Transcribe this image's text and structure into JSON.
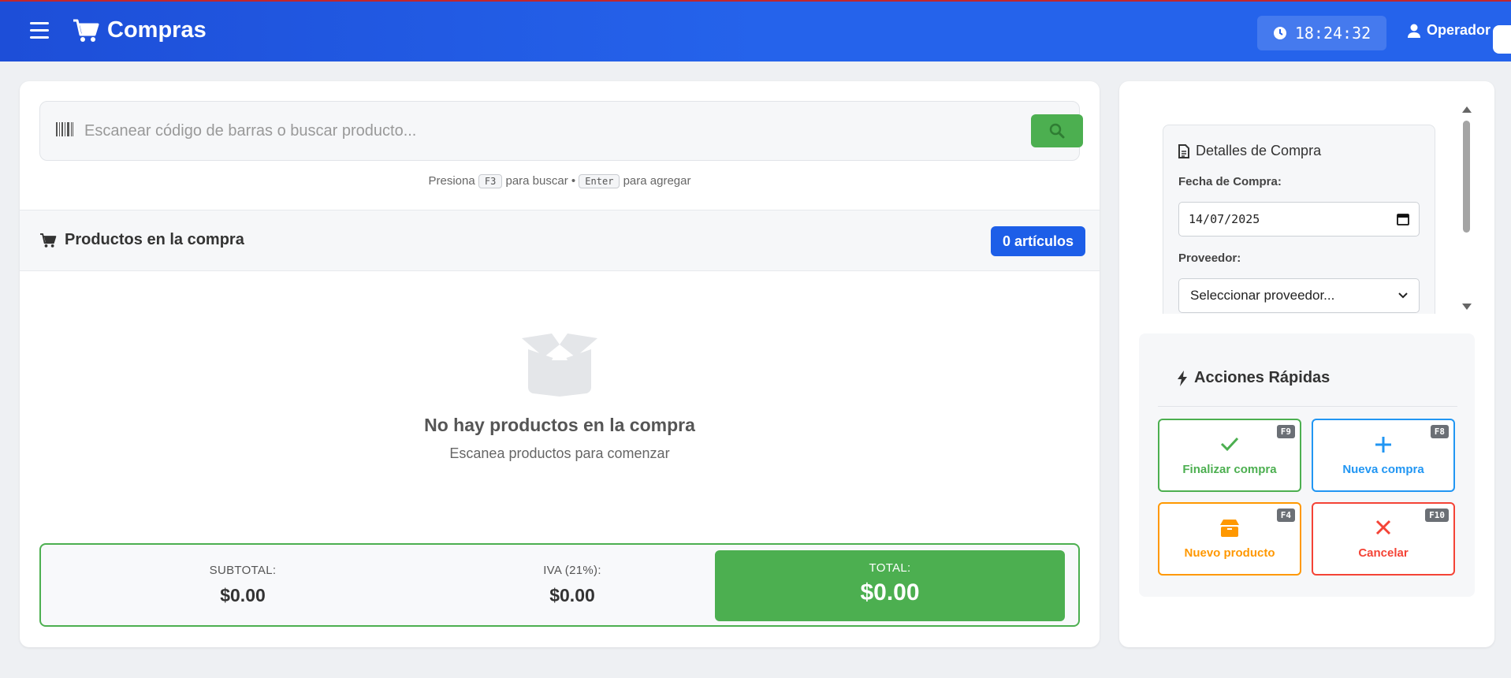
{
  "colors": {
    "header_bg": "#2563eb",
    "header_top_stripe": "#c0262d",
    "success": "#4caf50",
    "primary_badge": "#1d5ee8",
    "info": "#2196f3",
    "warning": "#ff9800",
    "danger": "#f44336"
  },
  "header": {
    "menu_icon": "hamburger-menu-icon",
    "brand_icon": "shopping-cart-icon",
    "title": "Compras",
    "clock_icon": "clock-icon",
    "clock": "18:24:32",
    "user_icon": "user-icon",
    "user": "Operador"
  },
  "search": {
    "icon": "barcode-icon",
    "placeholder": "Escanear código de barras o buscar producto...",
    "button_icon": "search-icon",
    "hint_prefix": "Presiona",
    "hint_key1": "F3",
    "hint_mid": "para buscar •",
    "hint_key2": "Enter",
    "hint_suffix": "para agregar"
  },
  "products": {
    "icon": "shopping-cart-icon",
    "title": "Productos en la compra",
    "count": "0 artículos",
    "empty_icon": "box-open-icon",
    "empty_title": "No hay productos en la compra",
    "empty_subtitle": "Escanea productos para comenzar"
  },
  "totals": {
    "subtotal_label": "SUBTOTAL:",
    "subtotal": "$0.00",
    "iva_label": "IVA (21%):",
    "iva": "$0.00",
    "total_label": "TOTAL:",
    "total": "$0.00"
  },
  "details": {
    "icon": "document-icon",
    "title": "Detalles de Compra",
    "date_label": "Fecha de Compra:",
    "date_value": "14/07/2025",
    "date_picker_icon": "calendar-icon",
    "supplier_label": "Proveedor:",
    "supplier_value": "Seleccionar proveedor...",
    "supplier_chevron": "chevron-down-icon"
  },
  "quick_actions": {
    "icon": "bolt-icon",
    "title": "Acciones Rápidas",
    "items": [
      {
        "label": "Finalizar compra",
        "key": "F9",
        "icon": "check-icon"
      },
      {
        "label": "Nueva compra",
        "key": "F8",
        "icon": "plus-icon"
      },
      {
        "label": "Nuevo producto",
        "key": "F4",
        "icon": "box-icon"
      },
      {
        "label": "Cancelar",
        "key": "F10",
        "icon": "x-icon"
      }
    ]
  }
}
